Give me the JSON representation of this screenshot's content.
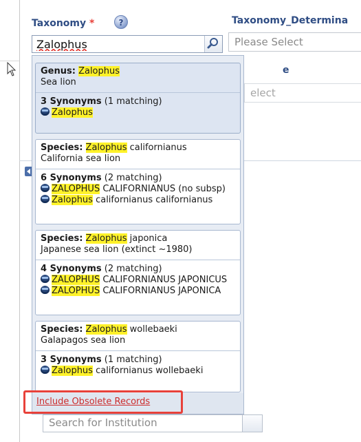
{
  "taxonomy_field": {
    "label": "Taxonomy",
    "required_mark": "*",
    "help_icon": "question-mark-icon",
    "value": "Zalophus",
    "search_icon": "magnifier-icon"
  },
  "determination_field": {
    "label": "Taxonomy_Determina",
    "placeholder": "Please Select"
  },
  "partial_behind": {
    "label_fragment": "e",
    "select_fragment": "elect",
    "institution_placeholder": "Search for Institution"
  },
  "results": [
    {
      "kind": "Genus:",
      "name_highlight": "Zalophus",
      "name_rest": "",
      "common_name": "Sea lion",
      "synonyms_count": "3 Synonyms",
      "synonyms_matching": "(1 matching)",
      "synonyms": [
        {
          "highlight": "Zalophus",
          "rest": ""
        }
      ]
    },
    {
      "kind": "Species:",
      "name_highlight": "Zalophus",
      "name_rest": " californianus",
      "common_name": "California sea lion",
      "synonyms_count": "6 Synonyms",
      "synonyms_matching": "(2 matching)",
      "synonyms": [
        {
          "highlight": "ZALOPHUS",
          "rest": " CALIFORNIANUS (no subsp)"
        },
        {
          "highlight": "Zalophus",
          "rest": " californianus californianus"
        }
      ]
    },
    {
      "kind": "Species:",
      "name_highlight": "Zalophus",
      "name_rest": " japonica",
      "common_name": "Japanese sea lion (extinct ~1980)",
      "synonyms_count": "4 Synonyms",
      "synonyms_matching": "(2 matching)",
      "synonyms": [
        {
          "highlight": "ZALOPHUS",
          "rest": " CALIFORNIANUS JAPONICUS"
        },
        {
          "highlight": "ZALOPHUS",
          "rest": " CALIFORNIANUS JAPONICA"
        }
      ]
    },
    {
      "kind": "Species:",
      "name_highlight": "Zalophus",
      "name_rest": " wollebaeki",
      "common_name": "Galapagos sea lion",
      "synonyms_count": "3 Synonyms",
      "synonyms_matching": "(1 matching)",
      "synonyms": [
        {
          "highlight": "Zalophus",
          "rest": " californianus wollebaeki"
        }
      ]
    }
  ],
  "include_obsolete_link": "Include Obsolete Records",
  "colors": {
    "label_blue": "#2f4d84",
    "required_red": "#e8413a",
    "highlight_yellow": "#fff22a",
    "link_red": "#cc2b2b",
    "annotation_red": "#e8413a",
    "selected_card": "#dde5f2"
  }
}
